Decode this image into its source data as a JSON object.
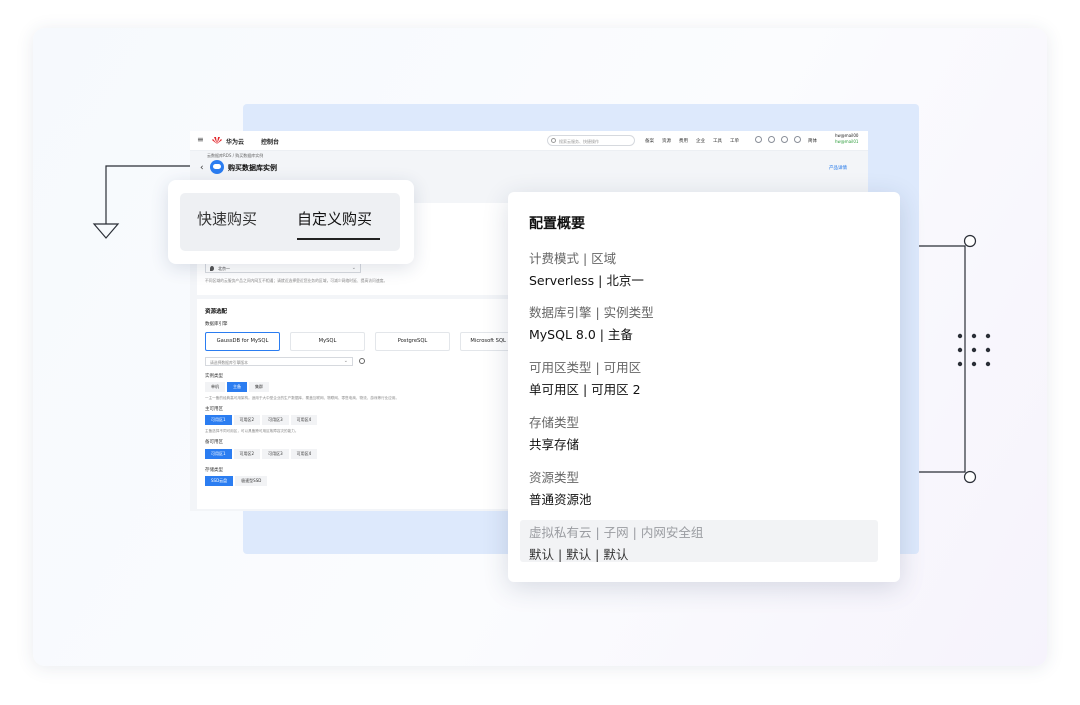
{
  "console": {
    "brand": "华为云",
    "console_label": "控制台",
    "search_placeholder": "搜索云服务、快捷操作",
    "nav": [
      "备案",
      "资源",
      "费用",
      "企业",
      "工具",
      "工单"
    ],
    "lang": "简体",
    "user": {
      "name": "hw@mail00",
      "badge": "hw@mail01"
    },
    "breadcrumb": "云数据库RDS / 购买数据库实例",
    "page_title": "购买数据库实例",
    "docs_link": "产品详情",
    "region": "北京一",
    "region_hint": "不同区域的云服务产品之间内网互不相通；请就近选择靠近您业务的区域，可减少网络时延、提高访问速度。",
    "resource_section": "资源选配",
    "engine_label": "数据库引擎",
    "engines": [
      "GaussDB for MySQL",
      "MySQL",
      "PostgreSQL",
      "Microsoft SQL Server"
    ],
    "version_placeholder": "请选择数据库引擎版本",
    "instance_type_label": "实例类型",
    "instance_types": [
      "单机",
      "主备",
      "集群"
    ],
    "instance_hint": "一主一备的经典高可用架构。适用于大中型企业的生产数据库，覆盖互联网、物联网、零售电商、物流、游戏等行业应用。",
    "primary_az_label": "主可用区",
    "primary_azs": [
      "可用区1",
      "可用区2",
      "可用区3",
      "可用区4"
    ],
    "az_hint": "主备选择不同可用区，可以具备跨可用区故障容灾的能力。",
    "standby_az_label": "备可用区",
    "standby_azs": [
      "可用区1",
      "可用区2",
      "可用区3",
      "可用区4"
    ],
    "storage_label": "存储类型",
    "storage_types": [
      "SSD云盘",
      "极速型SSD"
    ]
  },
  "purchase_mode": {
    "quick": "快速购买",
    "custom": "自定义购买"
  },
  "summary": {
    "title": "配置概要",
    "items": [
      {
        "label": "计费模式 | 区域",
        "value": "Serverless | 北京一"
      },
      {
        "label": "数据库引擎 | 实例类型",
        "value": "MySQL 8.0 | 主备"
      },
      {
        "label": "可用区类型 | 可用区",
        "value": "单可用区 | 可用区 2"
      },
      {
        "label": "存储类型",
        "value": "共享存储"
      },
      {
        "label": "资源类型",
        "value": "普通资源池"
      },
      {
        "label": "虚拟私有云 | 子网 | 内网安全组",
        "value": "默认 | 默认 | 默认"
      }
    ]
  },
  "colors": {
    "accent": "#2b7df1",
    "panel": "#dde9fc"
  }
}
